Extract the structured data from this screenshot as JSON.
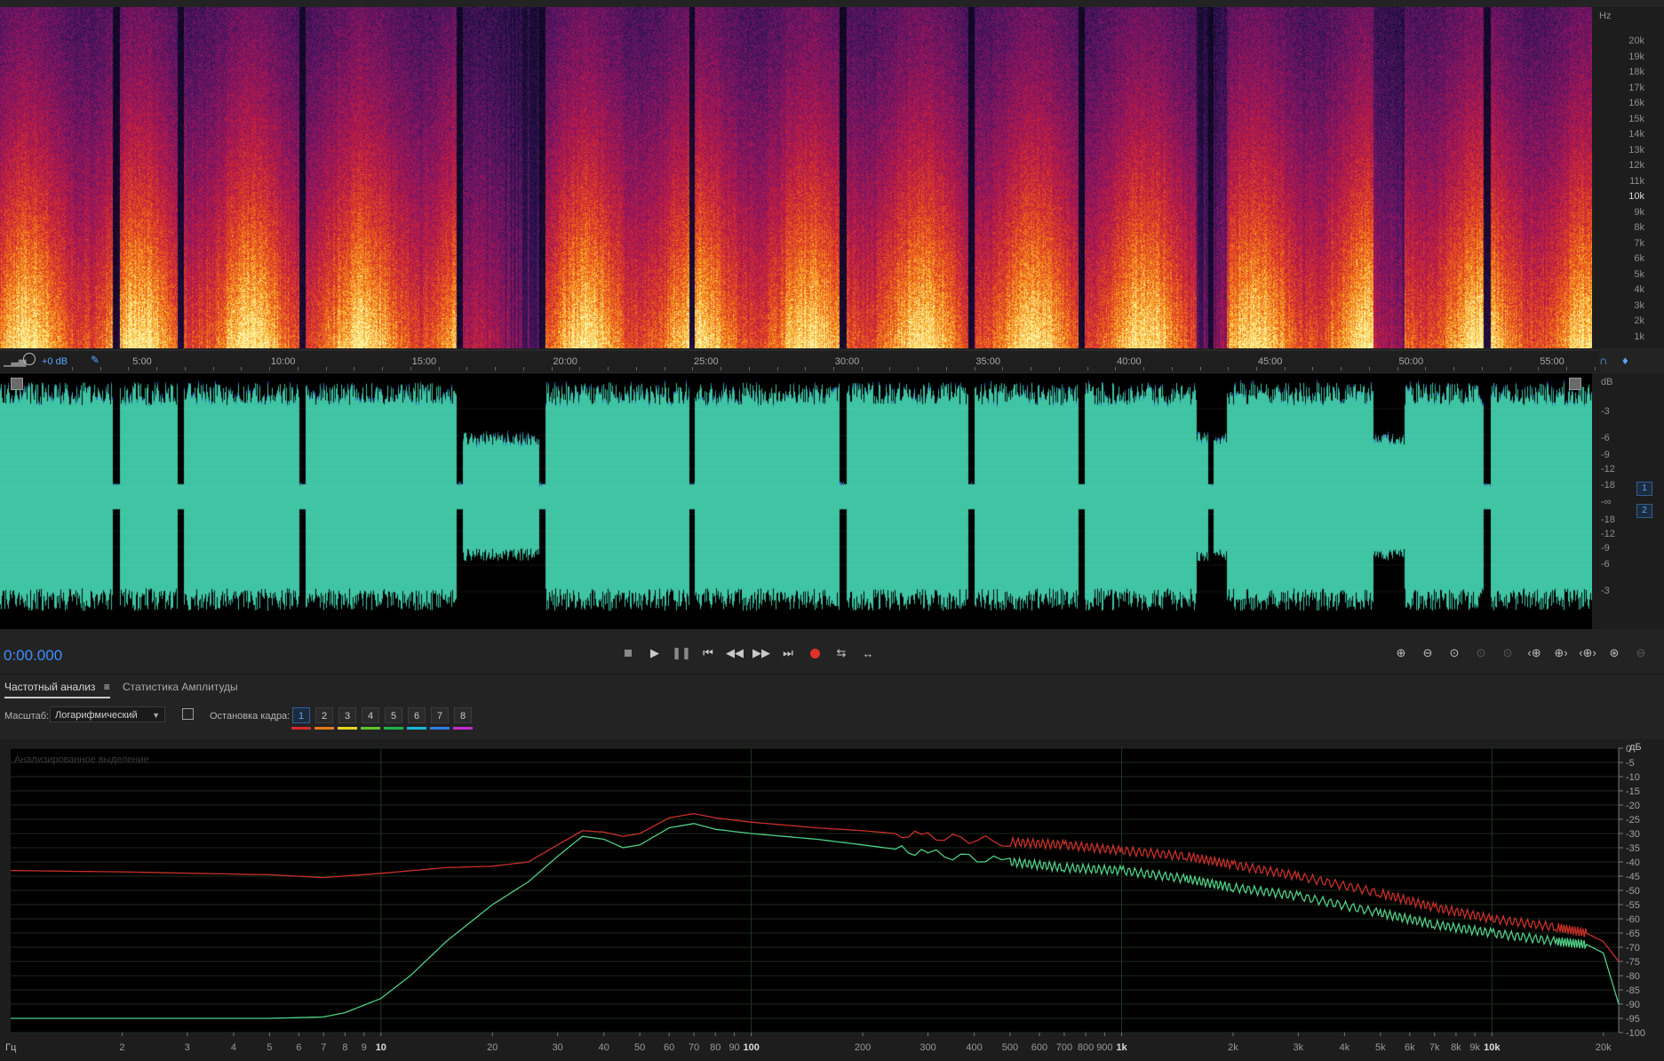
{
  "spectral": {
    "unit": "Hz",
    "freq_labels": [
      "20k",
      "19k",
      "18k",
      "17k",
      "16k",
      "15k",
      "14k",
      "13k",
      "12k",
      "11k",
      "10k",
      "9k",
      "8k",
      "7k",
      "6k",
      "5k",
      "4k",
      "3k",
      "2k",
      "1k"
    ]
  },
  "ruler": {
    "gain": "+0 dB",
    "times": [
      "5:00",
      "10:00",
      "15:00",
      "20:00",
      "25:00",
      "30:00",
      "35:00",
      "40:00",
      "45:00",
      "50:00",
      "55:00"
    ]
  },
  "waveform": {
    "unit": "dB",
    "db_labels": [
      "-3",
      "-6",
      "-9",
      "-12",
      "-18",
      "-∞",
      "-18",
      "-12",
      "-9",
      "-6",
      "-3"
    ],
    "channels": [
      "1",
      "2"
    ],
    "color": "#3fc4a4"
  },
  "transport": {
    "timecode": "0:00.000",
    "record_color": "#e0322b"
  },
  "panel_tabs": {
    "frequency": "Частотный анализ",
    "amplitude": "Статистика Амплитуды"
  },
  "controls": {
    "scale_label": "Масштаб:",
    "scale_value": "Логарифмический",
    "freeze_label": "Остановка кадра:",
    "frames": [
      "1",
      "2",
      "3",
      "4",
      "5",
      "6",
      "7",
      "8"
    ],
    "frame_colors": [
      "#d42a2a",
      "#e27b1a",
      "#e8d61d",
      "#5ec42b",
      "#1fb24a",
      "#18b8d8",
      "#2d7fe8",
      "#c42bd1"
    ]
  },
  "frequency_chart": {
    "overlay_text": "Анализированное выделение",
    "unit_x": "Гц",
    "unit_y": "дБ"
  },
  "chart_data": {
    "type": "line",
    "xlabel": "Гц",
    "ylabel": "дБ",
    "x_scale": "log",
    "xlim": [
      1,
      22000
    ],
    "ylim": [
      -100,
      0
    ],
    "x_tick_labels": [
      "2",
      "3",
      "4",
      "5",
      "6",
      "7",
      "8",
      "9",
      "10",
      "20",
      "30",
      "40",
      "50",
      "60",
      "70",
      "80",
      "90",
      "100",
      "200",
      "300",
      "400",
      "500",
      "600",
      "700",
      "800",
      "900",
      "1k",
      "2k",
      "3k",
      "4k",
      "5k",
      "6k",
      "7k",
      "8k",
      "9k",
      "10k",
      "20k"
    ],
    "x_tick_values": [
      2,
      3,
      4,
      5,
      6,
      7,
      8,
      9,
      10,
      20,
      30,
      40,
      50,
      60,
      70,
      80,
      90,
      100,
      200,
      300,
      400,
      500,
      600,
      700,
      800,
      900,
      1000,
      2000,
      3000,
      4000,
      5000,
      6000,
      7000,
      8000,
      9000,
      10000,
      20000
    ],
    "y_tick_labels": [
      "0",
      "-5",
      "-10",
      "-15",
      "-20",
      "-25",
      "-30",
      "-35",
      "-40",
      "-45",
      "-50",
      "-55",
      "-60",
      "-65",
      "-70",
      "-75",
      "-80",
      "-85",
      "-90",
      "-95",
      "-100"
    ],
    "y_tick_values": [
      0,
      -5,
      -10,
      -15,
      -20,
      -25,
      -30,
      -35,
      -40,
      -45,
      -50,
      -55,
      -60,
      -65,
      -70,
      -75,
      -80,
      -85,
      -90,
      -95,
      -100
    ],
    "series": [
      {
        "color": "#c8302a",
        "x": [
          1,
          2,
          5,
          7,
          10,
          15,
          20,
          25,
          30,
          35,
          40,
          45,
          50,
          60,
          70,
          80,
          100,
          150,
          200,
          300,
          500,
          700,
          1000,
          1500,
          2000,
          3000,
          5000,
          7000,
          10000,
          15000,
          18000,
          20000,
          22000
        ],
        "y": [
          -43,
          -43.5,
          -44.5,
          -45.5,
          -44,
          -42,
          -41.5,
          -40,
          -34,
          -29,
          -29.5,
          -31,
          -30,
          -24.5,
          -23,
          -24.5,
          -26,
          -28,
          -29,
          -31,
          -33,
          -34,
          -36,
          -38,
          -41,
          -45,
          -51,
          -56,
          -60,
          -63,
          -65,
          -68,
          -75
        ]
      },
      {
        "color": "#4fcf86",
        "x": [
          1,
          2,
          5,
          7,
          8,
          10,
          12,
          15,
          20,
          25,
          30,
          35,
          40,
          45,
          50,
          60,
          70,
          80,
          100,
          150,
          200,
          300,
          500,
          700,
          1000,
          1500,
          2000,
          3000,
          5000,
          7000,
          10000,
          15000,
          18000,
          20000,
          22000
        ],
        "y": [
          -95,
          -95,
          -95,
          -94.5,
          -93,
          -88,
          -80,
          -68,
          -55,
          -47,
          -38,
          -31,
          -32,
          -35,
          -34,
          -28,
          -26.5,
          -28.5,
          -30,
          -32,
          -34,
          -37,
          -40,
          -42,
          -43,
          -46,
          -49,
          -52,
          -58,
          -62,
          -65,
          -68,
          -69,
          -72,
          -90
        ]
      }
    ]
  }
}
